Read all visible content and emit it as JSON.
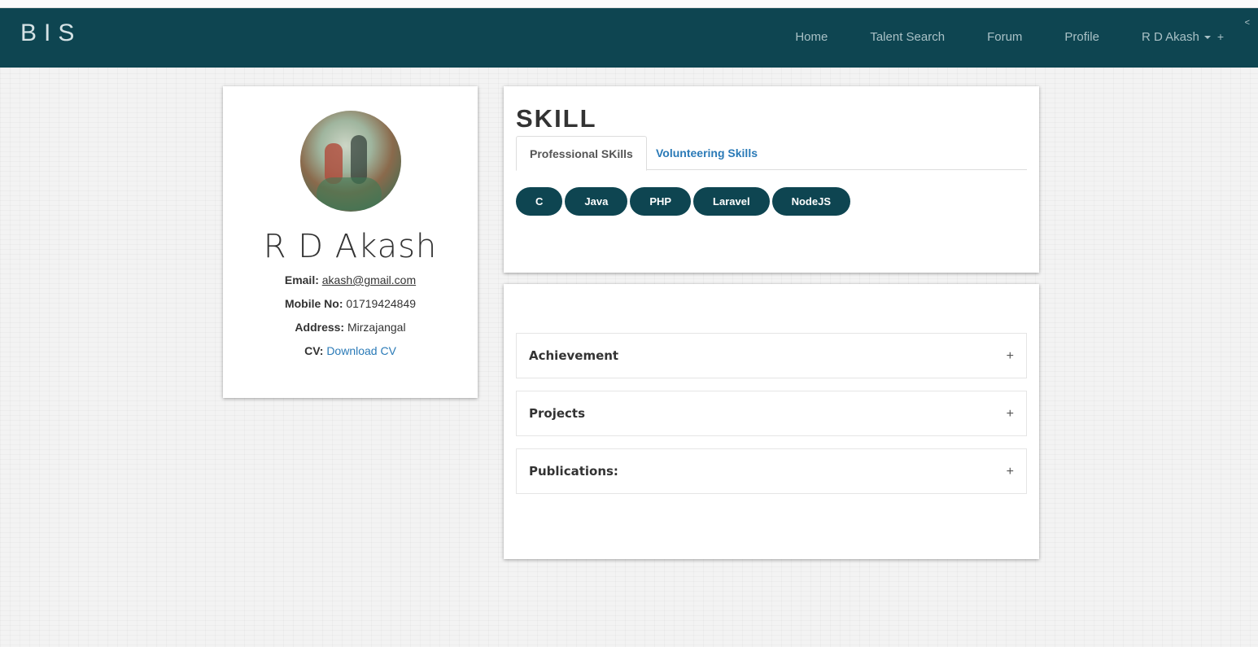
{
  "navbar": {
    "brand": "BIS",
    "links": [
      "Home",
      "Talent Search",
      "Forum",
      "Profile"
    ],
    "user_menu": "R D Akash",
    "user_menu_extra": "+",
    "corner_mark": "<"
  },
  "profile": {
    "name": "R D Akash",
    "email_label": "Email:",
    "email": "akash@gmail.com",
    "mobile_label": "Mobile No:",
    "mobile": "01719424849",
    "address_label": "Address:",
    "address": "Mirzajangal",
    "cv_label": "CV:",
    "cv_link": "Download CV"
  },
  "skills": {
    "title": "SKILL",
    "tabs": [
      "Professional SKills",
      "Volunteering Skills"
    ],
    "active_tab": "Professional SKills",
    "items": [
      "C",
      "Java",
      "PHP",
      "Laravel",
      "NodeJS"
    ]
  },
  "accordion": {
    "items": [
      "Achievement",
      "Projects",
      "Publications:"
    ],
    "expand_icon": "+"
  },
  "colors": {
    "navbar_bg": "#0e4551",
    "pill_bg": "#0e4551",
    "link": "#2a7ab7"
  }
}
